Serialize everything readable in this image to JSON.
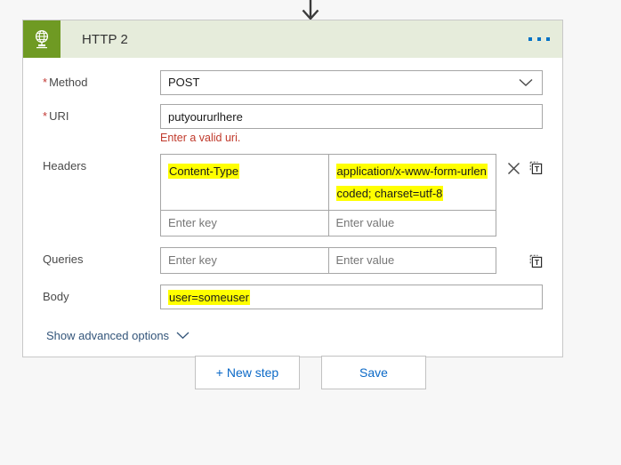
{
  "connector": {
    "icon": "arrow-down-icon"
  },
  "card": {
    "icon": "globe-network-icon",
    "title": "HTTP 2",
    "menu_icon": "ellipsis-icon",
    "fields": {
      "method": {
        "label": "Method",
        "required": true,
        "value": "POST",
        "chevron_icon": "chevron-down-icon"
      },
      "uri": {
        "label": "URI",
        "required": true,
        "value": "putyoururlhere",
        "error": "Enter a valid uri."
      },
      "headers": {
        "label": "Headers",
        "rows": [
          {
            "key": "Content-Type",
            "value": "application/x-www-form-urlencoded; charset=utf-8",
            "highlighted": true
          },
          {
            "key": "Enter key",
            "value": "Enter value",
            "highlighted": false
          }
        ],
        "delete_icon": "close-x-icon",
        "dynamic_icon": "dynamic-content-icon"
      },
      "queries": {
        "label": "Queries",
        "rows": [
          {
            "key": "Enter key",
            "value": "Enter value",
            "highlighted": false
          }
        ],
        "dynamic_icon": "dynamic-content-icon"
      },
      "body": {
        "label": "Body",
        "value": "user=someuser",
        "highlighted": true
      }
    },
    "advanced": {
      "label": "Show advanced options",
      "chevron_icon": "chevron-down-icon"
    }
  },
  "buttons": {
    "new_step": "+ New step",
    "save": "Save"
  },
  "colors": {
    "accent_green": "#6f9a23",
    "header_green": "#e6ecdb",
    "link_blue": "#0b69c7",
    "error_red": "#c0392b",
    "highlight_yellow": "#ffff00"
  }
}
